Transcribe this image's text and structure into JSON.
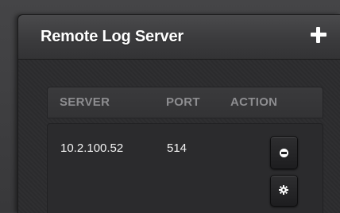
{
  "panel": {
    "title": "Remote Log Server",
    "add_label": "+"
  },
  "table": {
    "columns": [
      "SERVER",
      "PORT",
      "ACTION"
    ],
    "rows": [
      {
        "server": "10.2.100.52",
        "port": "514"
      }
    ]
  },
  "icons": {
    "add": "plus-icon",
    "remove": "minus-circle-icon",
    "edit": "gear-icon"
  },
  "colors": {
    "header_text": "#ffffff",
    "column_header_text": "#8d8d90",
    "cell_text": "#f2f2f2",
    "panel_bg": "#2e2e30"
  }
}
